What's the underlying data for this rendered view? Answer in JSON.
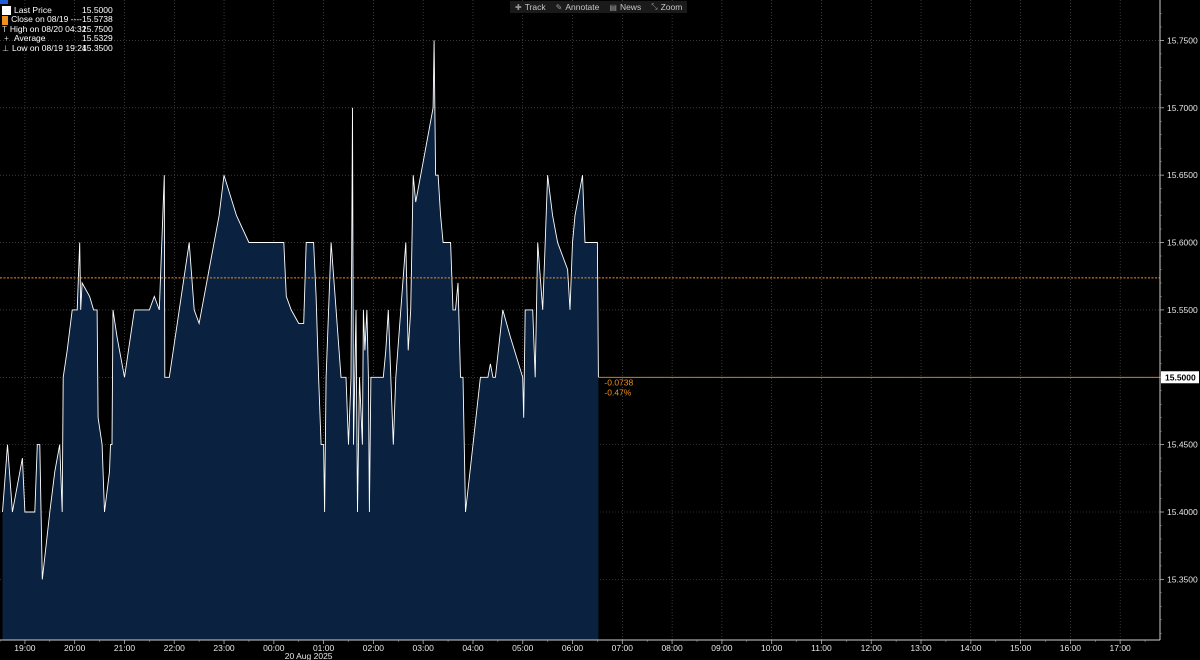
{
  "toolbar": [
    {
      "icon": "crosshair-icon",
      "glyph": "✚",
      "label": "Track"
    },
    {
      "icon": "pencil-icon",
      "glyph": "✎",
      "label": "Annotate"
    },
    {
      "icon": "news-icon",
      "glyph": "▤",
      "label": "News"
    },
    {
      "icon": "zoom-icon",
      "glyph": "⤡",
      "label": "Zoom"
    }
  ],
  "legend": [
    {
      "name": "Last Price",
      "value": "15.5000",
      "swatch": "square",
      "color": "#ffffff"
    },
    {
      "name": "Close on 08/19 ----",
      "value": "15.5738",
      "swatch": "square",
      "color": "#f0901c"
    },
    {
      "name": "High on 08/20 04:32",
      "value": "15.7500",
      "swatch": "T",
      "color": "#cccccc"
    },
    {
      "name": "Average",
      "value": "15.5329",
      "swatch": "+",
      "color": "#cccccc"
    },
    {
      "name": "Low on 08/19 19:24",
      "value": "15.3500",
      "swatch": "⊥",
      "color": "#cccccc"
    }
  ],
  "chart_data": {
    "type": "area",
    "date_label": "20 Aug 2025",
    "x_ticks": [
      "19:00",
      "20:00",
      "21:00",
      "22:00",
      "23:00",
      "00:00",
      "01:00",
      "02:00",
      "03:00",
      "04:00",
      "05:00",
      "06:00",
      "07:00",
      "08:00",
      "09:00",
      "10:00",
      "11:00",
      "12:00",
      "13:00",
      "14:00",
      "15:00",
      "16:00",
      "17:00"
    ],
    "x_range_hours": [
      18.5,
      41.8
    ],
    "y_ticks": [
      "15.3500",
      "15.4000",
      "15.4500",
      "15.5000",
      "15.5500",
      "15.6000",
      "15.6500",
      "15.7000",
      "15.7500"
    ],
    "ylim": [
      15.305,
      15.78
    ],
    "grid": true,
    "last_price_label": "15.5000",
    "last_price": 15.5,
    "prev_close": 15.5738,
    "change": "-0.0738",
    "change_pct": "-0.47%",
    "colors": {
      "fill": "#0a2240",
      "line": "#ffffff",
      "close_line": "#f0901c",
      "grid": "#5a5a5a"
    },
    "series": [
      {
        "points": [
          [
            18.55,
            15.4
          ],
          [
            18.65,
            15.45
          ],
          [
            18.75,
            15.4
          ],
          [
            18.85,
            15.42
          ],
          [
            18.95,
            15.44
          ],
          [
            19.0,
            15.4
          ],
          [
            19.2,
            15.4
          ],
          [
            19.25,
            15.45
          ],
          [
            19.3,
            15.45
          ],
          [
            19.35,
            15.35
          ],
          [
            19.5,
            15.4
          ],
          [
            19.6,
            15.43
          ],
          [
            19.7,
            15.45
          ],
          [
            19.75,
            15.4
          ],
          [
            19.77,
            15.5
          ],
          [
            19.85,
            15.52
          ],
          [
            19.95,
            15.55
          ],
          [
            20.05,
            15.55
          ],
          [
            20.1,
            15.6
          ],
          [
            20.12,
            15.55
          ],
          [
            20.15,
            15.57
          ],
          [
            20.3,
            15.56
          ],
          [
            20.38,
            15.55
          ],
          [
            20.45,
            15.55
          ],
          [
            20.47,
            15.47
          ],
          [
            20.55,
            15.45
          ],
          [
            20.6,
            15.4
          ],
          [
            20.7,
            15.43
          ],
          [
            20.72,
            15.45
          ],
          [
            20.75,
            15.45
          ],
          [
            20.77,
            15.55
          ],
          [
            20.85,
            15.53
          ],
          [
            21.0,
            15.5
          ],
          [
            21.2,
            15.55
          ],
          [
            21.5,
            15.55
          ],
          [
            21.6,
            15.56
          ],
          [
            21.7,
            15.55
          ],
          [
            21.8,
            15.65
          ],
          [
            21.81,
            15.5
          ],
          [
            21.9,
            15.5
          ],
          [
            22.3,
            15.6
          ],
          [
            22.4,
            15.55
          ],
          [
            22.5,
            15.54
          ],
          [
            22.7,
            15.58
          ],
          [
            22.9,
            15.62
          ],
          [
            23.0,
            15.65
          ],
          [
            23.25,
            15.62
          ],
          [
            23.5,
            15.6
          ],
          [
            23.75,
            15.6
          ],
          [
            24.0,
            15.6
          ],
          [
            24.2,
            15.6
          ],
          [
            24.25,
            15.56
          ],
          [
            24.35,
            15.55
          ],
          [
            24.5,
            15.54
          ],
          [
            24.6,
            15.54
          ],
          [
            24.65,
            15.6
          ],
          [
            24.8,
            15.6
          ],
          [
            24.85,
            15.56
          ],
          [
            24.9,
            15.5
          ],
          [
            24.95,
            15.45
          ],
          [
            25.0,
            15.45
          ],
          [
            25.02,
            15.4
          ],
          [
            25.05,
            15.5
          ],
          [
            25.15,
            15.6
          ],
          [
            25.25,
            15.55
          ],
          [
            25.35,
            15.5
          ],
          [
            25.45,
            15.5
          ],
          [
            25.5,
            15.45
          ],
          [
            25.55,
            15.5
          ],
          [
            25.58,
            15.7
          ],
          [
            25.6,
            15.45
          ],
          [
            25.65,
            15.55
          ],
          [
            25.68,
            15.4
          ],
          [
            25.72,
            15.5
          ],
          [
            25.78,
            15.45
          ],
          [
            25.8,
            15.55
          ],
          [
            25.83,
            15.52
          ],
          [
            25.87,
            15.55
          ],
          [
            25.9,
            15.5
          ],
          [
            25.92,
            15.4
          ],
          [
            25.95,
            15.5
          ],
          [
            26.1,
            15.5
          ],
          [
            26.2,
            15.5
          ],
          [
            26.25,
            15.52
          ],
          [
            26.3,
            15.55
          ],
          [
            26.35,
            15.5
          ],
          [
            26.4,
            15.45
          ],
          [
            26.45,
            15.5
          ],
          [
            26.55,
            15.55
          ],
          [
            26.65,
            15.6
          ],
          [
            26.7,
            15.52
          ],
          [
            26.75,
            15.55
          ],
          [
            26.8,
            15.65
          ],
          [
            26.85,
            15.63
          ],
          [
            27.0,
            15.66
          ],
          [
            27.2,
            15.7
          ],
          [
            27.22,
            15.75
          ],
          [
            27.25,
            15.65
          ],
          [
            27.3,
            15.65
          ],
          [
            27.35,
            15.62
          ],
          [
            27.4,
            15.6
          ],
          [
            27.55,
            15.6
          ],
          [
            27.6,
            15.55
          ],
          [
            27.65,
            15.55
          ],
          [
            27.7,
            15.57
          ],
          [
            27.75,
            15.5
          ],
          [
            27.8,
            15.5
          ],
          [
            27.85,
            15.4
          ],
          [
            28.0,
            15.45
          ],
          [
            28.15,
            15.5
          ],
          [
            28.3,
            15.5
          ],
          [
            28.35,
            15.51
          ],
          [
            28.4,
            15.5
          ],
          [
            28.45,
            15.5
          ],
          [
            28.6,
            15.55
          ],
          [
            28.75,
            15.53
          ],
          [
            29.0,
            15.5
          ],
          [
            29.02,
            15.47
          ],
          [
            29.05,
            15.55
          ],
          [
            29.2,
            15.55
          ],
          [
            29.25,
            15.5
          ],
          [
            29.3,
            15.6
          ],
          [
            29.4,
            15.55
          ],
          [
            29.45,
            15.6
          ],
          [
            29.5,
            15.65
          ],
          [
            29.6,
            15.62
          ],
          [
            29.7,
            15.6
          ],
          [
            29.8,
            15.59
          ],
          [
            29.9,
            15.58
          ],
          [
            29.95,
            15.55
          ],
          [
            30.0,
            15.6
          ],
          [
            30.05,
            15.62
          ],
          [
            30.1,
            15.63
          ],
          [
            30.2,
            15.65
          ],
          [
            30.25,
            15.6
          ],
          [
            30.5,
            15.6
          ],
          [
            30.52,
            15.5
          ]
        ]
      }
    ]
  }
}
